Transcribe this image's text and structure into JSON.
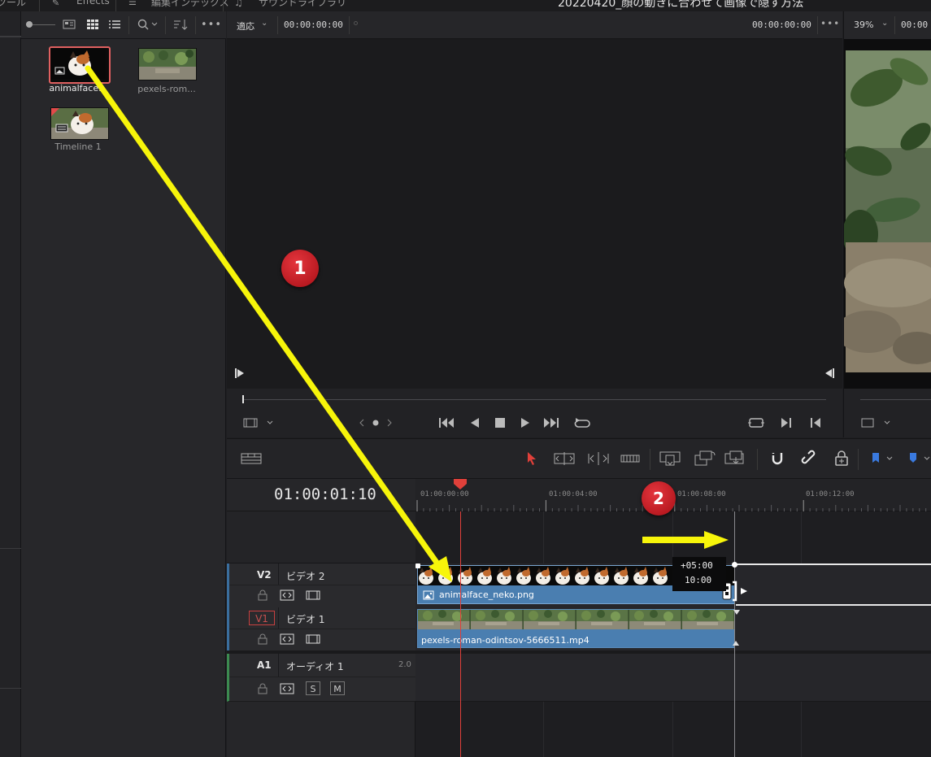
{
  "topbar": {
    "tools_label": "ツール",
    "effects_label": "Effects",
    "edit_index_label": "編集インデックス",
    "sound_library_label": "サウンドライブラリ",
    "project_title": "20220420_顔の動きに合わせて画像で隠す方法"
  },
  "media_pool": {
    "items": [
      {
        "label": "animalface..."
      },
      {
        "label": "pexels-rom..."
      },
      {
        "label": "Timeline 1"
      }
    ]
  },
  "source_viewer": {
    "zoom_label": "適応",
    "timecode_left": "00:00:00:00",
    "timecode_right": "00:00:00:00"
  },
  "timeline_viewer": {
    "zoom_label": "39%",
    "timecode": "00:00"
  },
  "timeline": {
    "current_timecode": "01:00:01:10",
    "ruler_labels": [
      "01:00:00:00",
      "01:00:04:00",
      "01:00:08:00",
      "01:00:12:00"
    ],
    "tracks": [
      {
        "id": "V2",
        "name": "ビデオ 2"
      },
      {
        "id": "V1",
        "name": "ビデオ 1"
      },
      {
        "id": "A1",
        "name": "オーディオ 1",
        "channel": "2.0"
      }
    ],
    "clips": {
      "v2_clip": "animalface_neko.png",
      "v1_clip": "pexels-roman-odintsov-5666511.mp4"
    },
    "drag_tooltip": {
      "delta": "+05:00",
      "duration": "10:00"
    },
    "audio_buttons": {
      "solo": "S",
      "mute": "M"
    }
  },
  "annotations": {
    "badge1": "1",
    "badge2": "2",
    "arrow_color": "#f7f50a",
    "badge_color": "#c8141c"
  },
  "colors": {
    "clip_blue": "#4a7eb0",
    "playhead": "#e0403a",
    "selection": "#e06060"
  }
}
